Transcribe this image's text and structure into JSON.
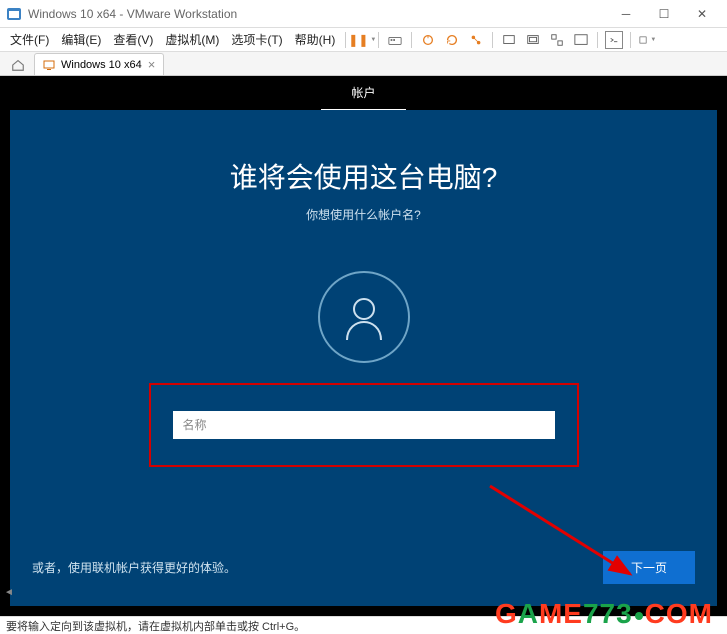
{
  "window": {
    "title": "Windows 10 x64 - VMware Workstation"
  },
  "menu": {
    "file": "文件(F)",
    "edit": "编辑(E)",
    "view": "查看(V)",
    "vm": "虚拟机(M)",
    "tabs": "选项卡(T)",
    "help": "帮助(H)"
  },
  "tab": {
    "label": "Windows 10 x64"
  },
  "oobe": {
    "topbar_tab": "帐户",
    "heading": "谁将会使用这台电脑?",
    "subheading": "你想使用什么帐户名?",
    "name_placeholder": "名称",
    "alt_link": "或者，使用联机帐户获得更好的体验。",
    "next": "下一页"
  },
  "status": {
    "hint": "要将输入定向到该虚拟机，请在虚拟机内部单击或按 Ctrl+G。"
  },
  "watermark": {
    "brand1": "G",
    "brand2": "A",
    "brand3": "ME",
    "num": "773",
    "tld": "COM"
  }
}
